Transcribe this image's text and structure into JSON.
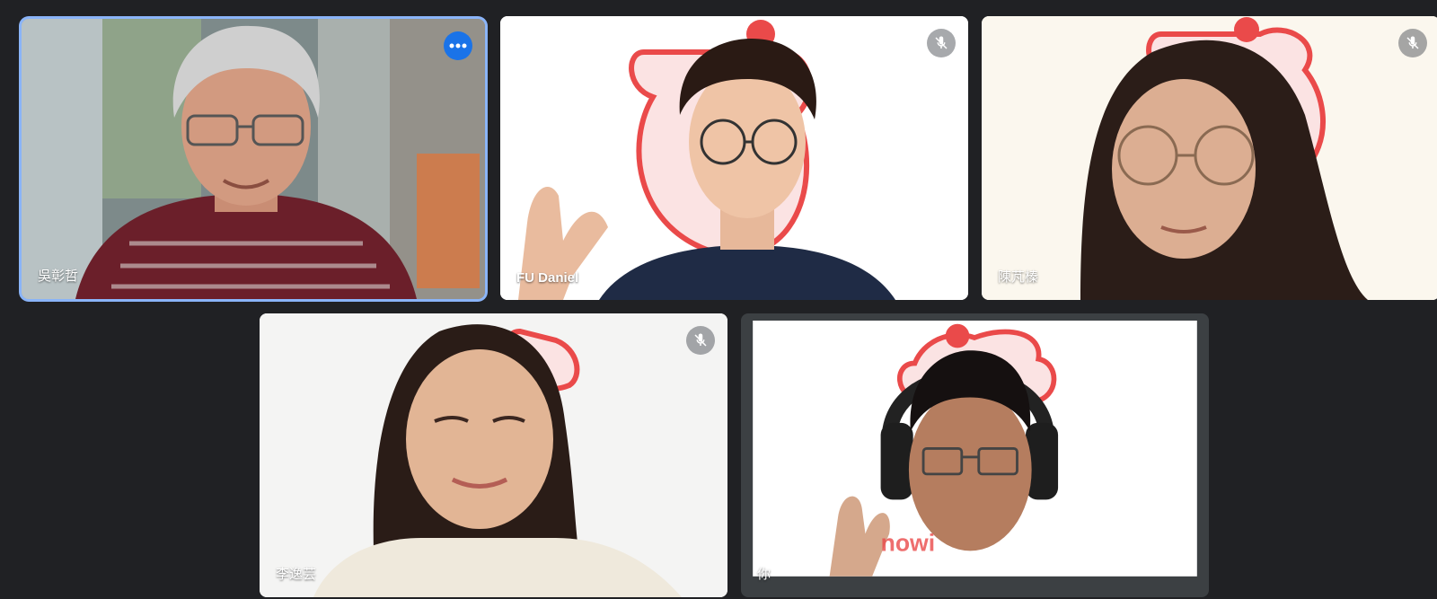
{
  "participants": [
    {
      "name": "吳彰哲",
      "muted": false,
      "active_speaker": true,
      "more_options_icon": "more-horiz-icon"
    },
    {
      "name": "FU Daniel",
      "muted": true,
      "mute_icon": "mic-off-icon"
    },
    {
      "name": "陳芃榛",
      "muted": true,
      "mute_icon": "mic-off-icon"
    },
    {
      "name": "李逸芸",
      "muted": true,
      "mute_icon": "mic-off-icon"
    },
    {
      "name": "你",
      "muted": false,
      "self_view": true
    }
  ],
  "colors": {
    "background": "#202124",
    "active_border": "#8ab4f8",
    "more_button": "#1a73e8",
    "sticker_red": "#ea4a4a"
  }
}
